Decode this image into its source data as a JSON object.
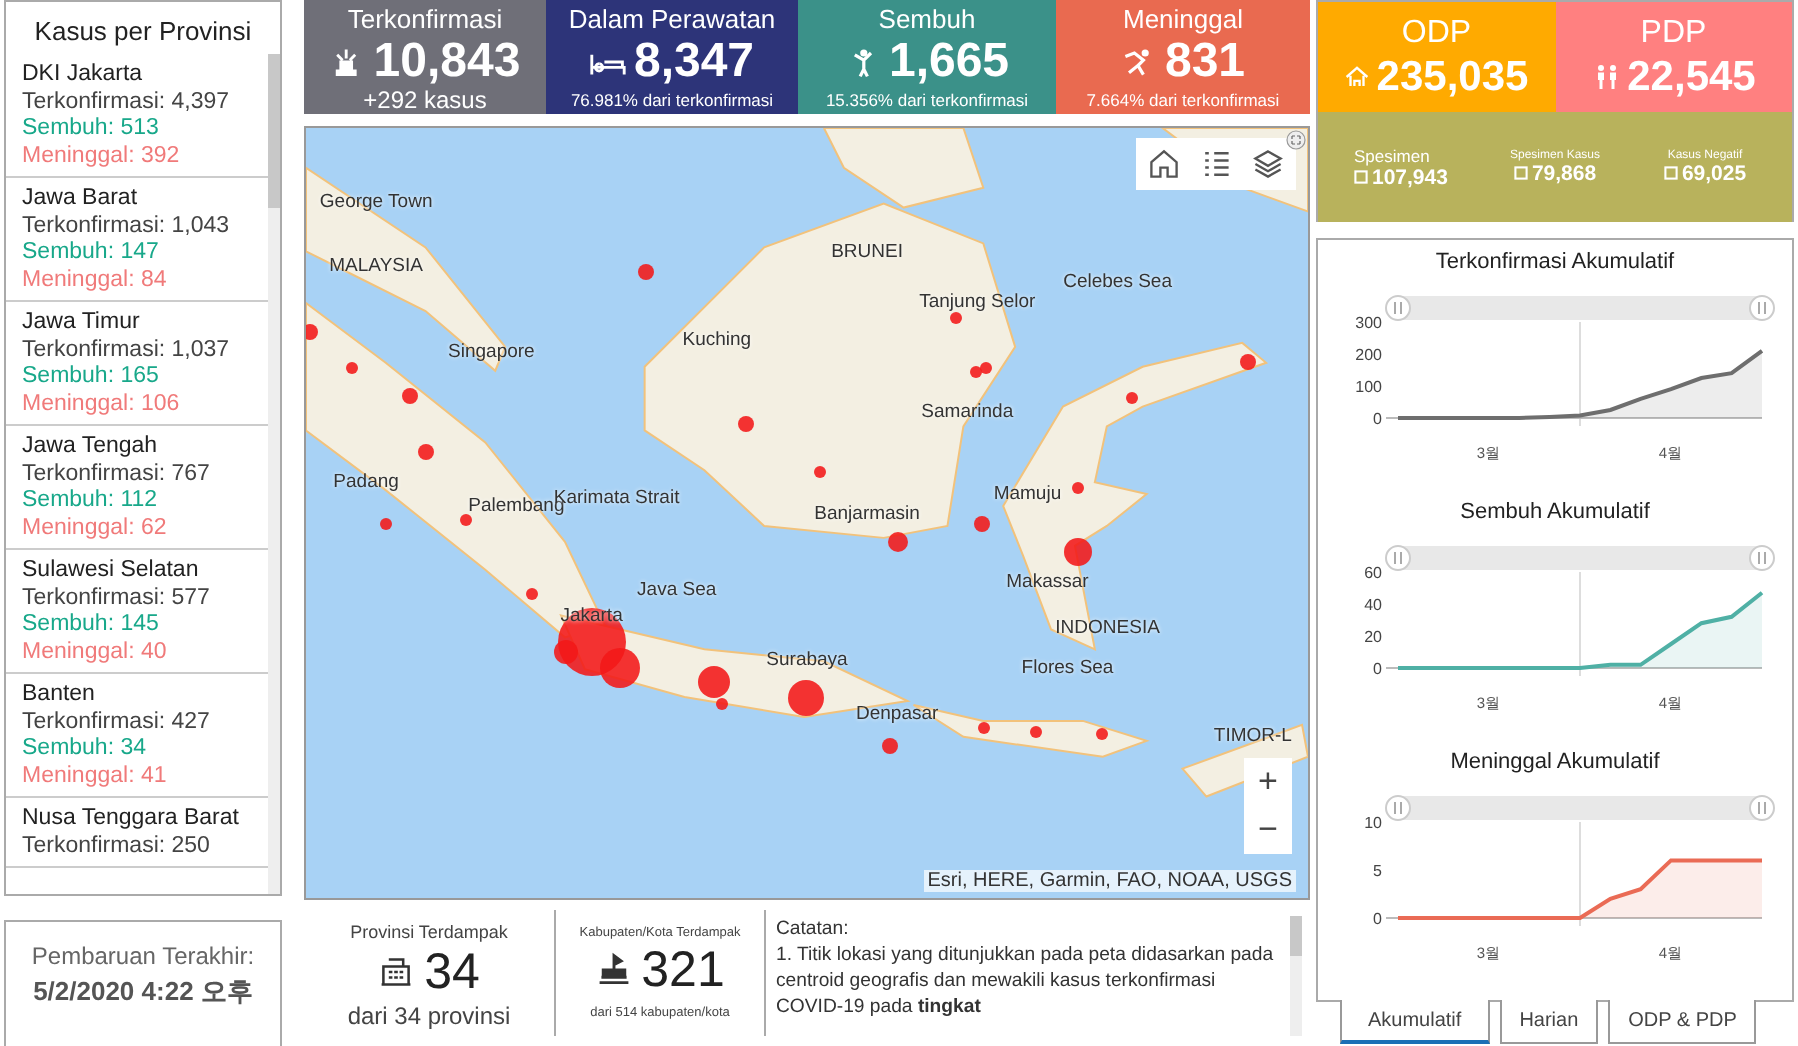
{
  "province_panel": {
    "title": "Kasus per Provinsi",
    "items": [
      {
        "name": "DKI Jakarta",
        "confirmed": "Terkonfirmasi: 4,397",
        "recovered": "Sembuh: 513",
        "deaths": "Meninggal: 392"
      },
      {
        "name": "Jawa Barat",
        "confirmed": "Terkonfirmasi: 1,043",
        "recovered": "Sembuh: 147",
        "deaths": "Meninggal: 84"
      },
      {
        "name": "Jawa Timur",
        "confirmed": "Terkonfirmasi: 1,037",
        "recovered": "Sembuh: 165",
        "deaths": "Meninggal: 106"
      },
      {
        "name": "Jawa Tengah",
        "confirmed": "Terkonfirmasi: 767",
        "recovered": "Sembuh: 112",
        "deaths": "Meninggal: 62"
      },
      {
        "name": "Sulawesi Selatan",
        "confirmed": "Terkonfirmasi: 577",
        "recovered": "Sembuh: 145",
        "deaths": "Meninggal: 40"
      },
      {
        "name": "Banten",
        "confirmed": "Terkonfirmasi: 427",
        "recovered": "Sembuh: 34",
        "deaths": "Meninggal: 41"
      },
      {
        "name": "Nusa Tenggara Barat",
        "confirmed": "Terkonfirmasi: 250"
      }
    ]
  },
  "update": {
    "label": "Pembaruan Terakhir:",
    "value": "5/2/2020 4:22 오후"
  },
  "stats": [
    {
      "kind": "confirmed",
      "title": "Terkonfirmasi",
      "value": "10,843",
      "note": "+292 kasus"
    },
    {
      "kind": "treated",
      "title": "Dalam Perawatan",
      "value": "8,347",
      "note": "76.981% dari terkonfirmasi"
    },
    {
      "kind": "recovered",
      "title": "Sembuh",
      "value": "1,665",
      "note": "15.356% dari terkonfirmasi"
    },
    {
      "kind": "deaths",
      "title": "Meninggal",
      "value": "831",
      "note": "7.664% dari terkonfirmasi"
    }
  ],
  "map": {
    "place_labels": [
      "George Town",
      "MALAYSIA",
      "BRUNEI",
      "Tanjung Selor",
      "Celebes Sea",
      "Singapore",
      "Kuching",
      "Samarinda",
      "Padang",
      "Palembang",
      "Karimata Strait",
      "Mamuju",
      "Banjarmasin",
      "Java Sea",
      "Makassar",
      "INDONESIA",
      "Jakarta",
      "Surabaya",
      "Flores Sea",
      "Denpasar",
      "TIMOR-L"
    ],
    "zoom_in": "+",
    "zoom_out": "−",
    "attribution": "Esri, HERE, Garmin, FAO, NOAA, USGS"
  },
  "impact": {
    "provinces": {
      "title": "Provinsi Terdampak",
      "value": "34",
      "note": "dari 34 provinsi"
    },
    "regencies": {
      "title": "Kabupaten/Kota Terdampak",
      "value": "321",
      "note": "dari 514 kabupaten/kota"
    },
    "notes": {
      "title": "Catatan:",
      "text": "1. Titik lokasi yang ditunjukkan pada peta didasarkan pada centroid geografis dan mewakili kasus terkonfirmasi COVID-19 pada **tingkat**"
    }
  },
  "suspects": {
    "odp": {
      "title": "ODP",
      "value": "235,035"
    },
    "pdp": {
      "title": "PDP",
      "value": "22,545"
    },
    "specimens": [
      {
        "label": "Spesimen",
        "value": "107,943"
      },
      {
        "label": "Spesimen Kasus",
        "value": "79,868"
      },
      {
        "label": "Kasus Negatif",
        "value": "69,025"
      }
    ]
  },
  "charts": [
    {
      "chart_data": {
        "type": "area",
        "title": "Terkonfirmasi Akumulatif",
        "categories": [
          null,
          null,
          null,
          "3월",
          null,
          null,
          null,
          null,
          null,
          "4월",
          null,
          null,
          null
        ],
        "ylim": [
          0,
          300
        ],
        "yticks": [
          0,
          100,
          200,
          300
        ],
        "series": [
          {
            "color": "#6e6e6e",
            "values": [
              0,
              0,
              0,
              0,
              0,
              3,
              8,
              25,
              60,
              90,
              125,
              140,
              210
            ]
          }
        ]
      }
    },
    {
      "chart_data": {
        "type": "area",
        "title": "Sembuh Akumulatif",
        "categories": [
          null,
          null,
          null,
          "3월",
          null,
          null,
          null,
          null,
          null,
          "4월",
          null,
          null,
          null
        ],
        "ylim": [
          0,
          60
        ],
        "yticks": [
          0,
          20,
          40,
          60
        ],
        "series": [
          {
            "color": "#4fb0a5",
            "values": [
              0,
              0,
              0,
              0,
              0,
              0,
              0,
              2,
              2,
              15,
              28,
              32,
              47
            ]
          }
        ]
      }
    },
    {
      "chart_data": {
        "type": "area",
        "title": "Meninggal Akumulatif",
        "categories": [
          null,
          null,
          null,
          "3월",
          null,
          null,
          null,
          null,
          null,
          "4월",
          null,
          null,
          null
        ],
        "ylim": [
          0,
          10
        ],
        "yticks": [
          0,
          5,
          10
        ],
        "series": [
          {
            "color": "#ea6b55",
            "values": [
              0,
              0,
              0,
              0,
              0,
              0,
              0,
              2,
              3,
              6,
              6,
              6,
              6
            ]
          }
        ]
      }
    }
  ],
  "tabs": [
    {
      "label": "Akumulatif",
      "selected": true
    },
    {
      "label": "Harian",
      "selected": false
    },
    {
      "label": "ODP & PDP",
      "selected": false
    }
  ]
}
